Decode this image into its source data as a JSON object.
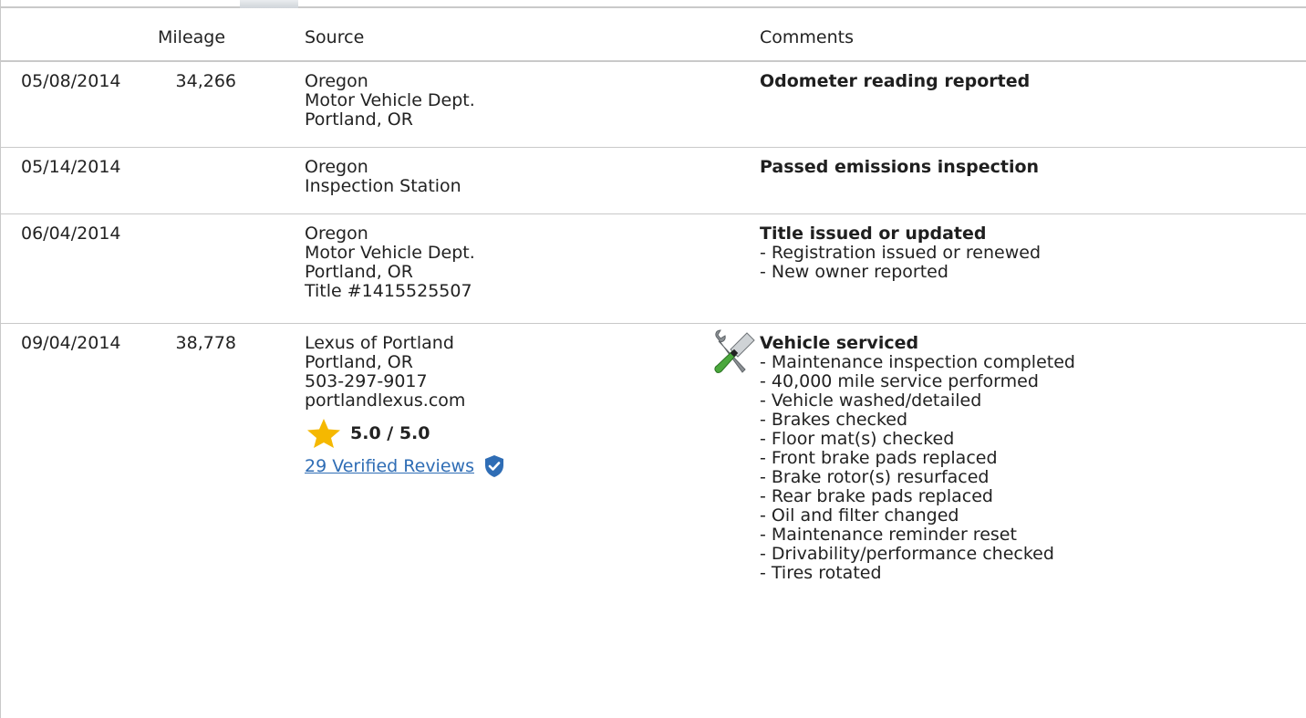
{
  "header": {
    "mileage": "Mileage",
    "source": "Source",
    "comments": "Comments"
  },
  "records": [
    {
      "date": "05/08/2014",
      "mileage": "34,266",
      "source": [
        "Oregon",
        "Motor Vehicle Dept.",
        "Portland, OR"
      ],
      "headline": "Odometer reading reported",
      "details": []
    },
    {
      "date": "05/14/2014",
      "mileage": "",
      "source": [
        "Oregon",
        "Inspection Station"
      ],
      "headline": "Passed emissions inspection",
      "details": []
    },
    {
      "date": "06/04/2014",
      "mileage": "",
      "source": [
        "Oregon",
        "Motor Vehicle Dept.",
        "Portland, OR",
        "Title #1415525507"
      ],
      "headline": "Title issued or updated",
      "details": [
        "- Registration issued or renewed",
        "- New owner reported"
      ]
    },
    {
      "date": "09/04/2014",
      "mileage": "38,778",
      "source": [
        "Lexus of Portland",
        "Portland, OR",
        "503-297-9017",
        "portlandlexus.com"
      ],
      "rating": "5.0 / 5.0",
      "reviews": "29 Verified Reviews",
      "icon": "wrench-screwdriver-icon",
      "headline": "Vehicle serviced",
      "details": [
        "- Maintenance inspection completed",
        "- 40,000 mile service performed",
        "- Vehicle washed/detailed",
        "- Brakes checked",
        "- Floor mat(s) checked",
        "- Front brake pads replaced",
        "- Brake rotor(s) resurfaced",
        "- Rear brake pads replaced",
        "- Oil and filter changed",
        "- Maintenance reminder reset",
        "- Drivability/performance checked",
        "- Tires rotated"
      ]
    }
  ],
  "colors": {
    "link": "#2f6db5",
    "star": "#f5b800",
    "verified": "#2f6db5",
    "divider": "#c9c9c9"
  }
}
